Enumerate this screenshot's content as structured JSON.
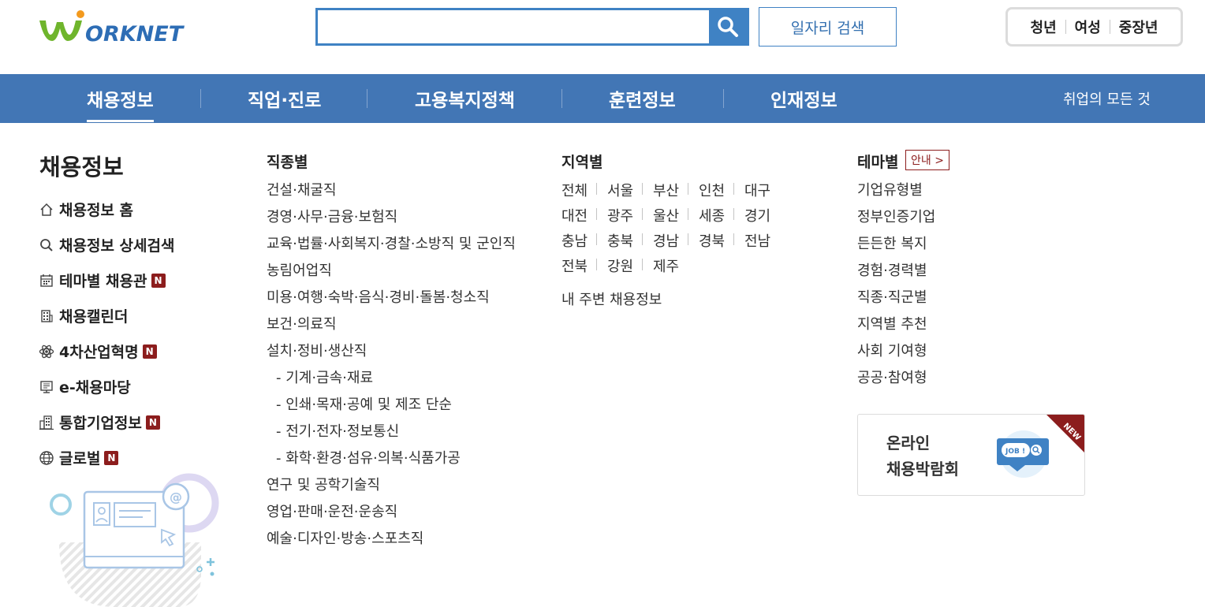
{
  "header": {
    "logo_text": "WORKNET",
    "search": {
      "value": "",
      "placeholder": ""
    },
    "search_button_icon": "search-icon",
    "job_search_label": "일자리 검색",
    "audience": [
      "청년",
      "여성",
      "중장년"
    ]
  },
  "nav": {
    "items": [
      "채용정보",
      "직업·진로",
      "고용복지정책",
      "훈련정보",
      "인재정보"
    ],
    "active_index": 0,
    "all_label": "취업의 모든 것"
  },
  "sidebar": {
    "title": "채용정보",
    "items": [
      {
        "label": "채용정보 홈",
        "icon": "home-icon",
        "new": false
      },
      {
        "label": "채용정보 상세검색",
        "icon": "search-icon",
        "new": false
      },
      {
        "label": "테마별 채용관",
        "icon": "calendar-icon",
        "new": true
      },
      {
        "label": "채용캘린더",
        "icon": "building-icon",
        "new": false
      },
      {
        "label": "4차산업혁명",
        "icon": "atom-icon",
        "new": true
      },
      {
        "label": "e-채용마당",
        "icon": "monitor-icon",
        "new": false
      },
      {
        "label": "통합기업정보",
        "icon": "company-icon",
        "new": true
      },
      {
        "label": "글로벌",
        "icon": "globe-icon",
        "new": true
      }
    ],
    "new_badge": "N"
  },
  "job_types": {
    "title": "직종별",
    "items": [
      {
        "label": "건설·채굴직",
        "sub": false
      },
      {
        "label": "경영·사무·금융·보험직",
        "sub": false
      },
      {
        "label": "교육·법률·사회복지·경찰·소방직 및 군인직",
        "sub": false
      },
      {
        "label": "농림어업직",
        "sub": false
      },
      {
        "label": "미용·여행·숙박·음식·경비·돌봄·청소직",
        "sub": false
      },
      {
        "label": "보건·의료직",
        "sub": false
      },
      {
        "label": "설치·정비·생산직",
        "sub": false
      },
      {
        "label": "- 기계·금속·재료",
        "sub": true
      },
      {
        "label": "- 인쇄·목재·공예 및 제조 단순",
        "sub": true
      },
      {
        "label": "- 전기·전자·정보통신",
        "sub": true
      },
      {
        "label": "- 화학·환경·섬유·의복·식품가공",
        "sub": true
      },
      {
        "label": "연구 및 공학기술직",
        "sub": false
      },
      {
        "label": "영업·판매·운전·운송직",
        "sub": false
      },
      {
        "label": "예술·디자인·방송·스포츠직",
        "sub": false
      }
    ]
  },
  "regions": {
    "title": "지역별",
    "rows": [
      [
        "전체",
        "서울",
        "부산",
        "인천",
        "대구"
      ],
      [
        "대전",
        "광주",
        "울산",
        "세종",
        "경기"
      ],
      [
        "충남",
        "충북",
        "경남",
        "경북",
        "전남"
      ],
      [
        "전북",
        "강원",
        "제주"
      ]
    ],
    "nearby": "내 주변 채용정보"
  },
  "themes": {
    "title": "테마별",
    "guide_label": "안내 >",
    "items": [
      "기업유형별",
      "정부인증기업",
      "든든한 복지",
      "경험·경력별",
      "직종·직군별",
      "지역별 추천",
      "사회 기여형",
      "공공·참여형"
    ]
  },
  "banner": {
    "line1": "온라인",
    "line2": "채용박람회",
    "ribbon": "NEW",
    "icon_text": "JOB !"
  },
  "colors": {
    "brand_blue": "#4276b5",
    "accent_blue": "#3f82c4",
    "badge_red": "#8c1d1d",
    "logo_green": "#6fb52c",
    "logo_orange": "#f39a1e",
    "logo_blue": "#2d6db5"
  }
}
